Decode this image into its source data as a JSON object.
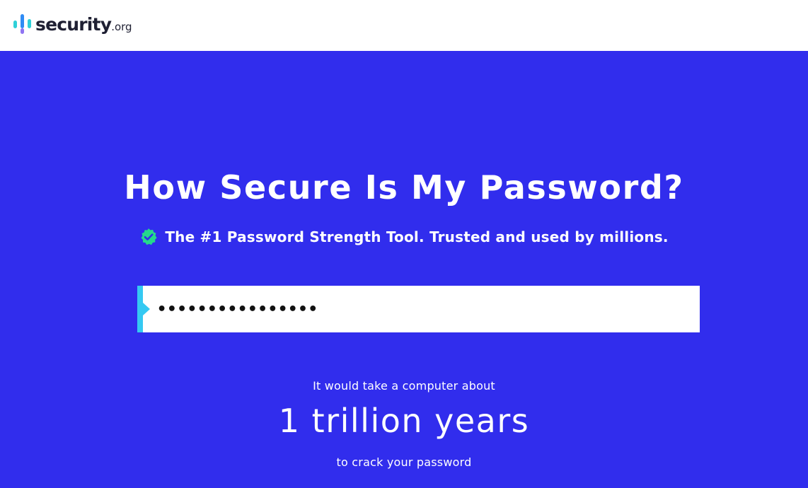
{
  "header": {
    "logo": {
      "word": "security",
      "tld": ".org",
      "mark_icon": "bar-chart-logo-icon",
      "mark_colors": [
        "#2fd0d8",
        "#2f8cf5",
        "#7b5cf0"
      ]
    }
  },
  "hero": {
    "background": "#312ded",
    "title": "How Secure Is My Password?",
    "subtitle": "The #1 Password Strength Tool. Trusted and used by millions.",
    "subtitle_icon": "verified-check-icon",
    "subtitle_icon_color": "#25d98c",
    "password_field": {
      "value": "••••••••••••••••",
      "accent_color": "#35c9f2"
    },
    "result": {
      "prefix": "It would take a computer about",
      "duration": "1 trillion years",
      "suffix": "to crack your password"
    }
  }
}
